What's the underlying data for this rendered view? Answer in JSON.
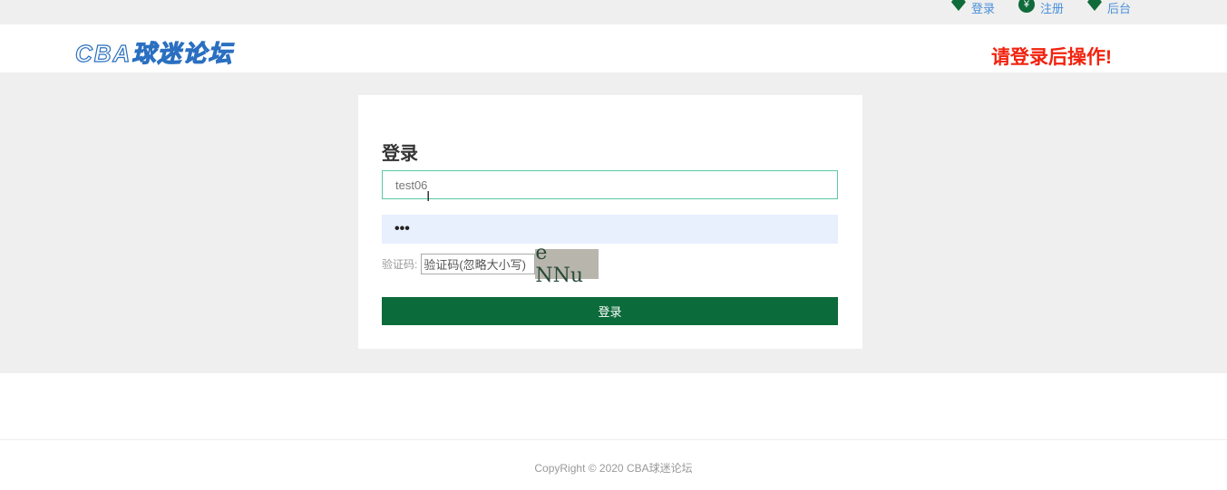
{
  "topbar": {
    "links": [
      {
        "label": "登录",
        "icon": "heart-icon"
      },
      {
        "label": "注册",
        "icon": "yen-icon"
      },
      {
        "label": "后台",
        "icon": "heart-icon"
      }
    ]
  },
  "header": {
    "logo": "CBA球迷论坛",
    "notice": "请登录后操作!"
  },
  "login": {
    "title": "登录",
    "username": "test06",
    "password": "•••",
    "captcha_label": "验证码:",
    "captcha_placeholder": "验证码(忽略大小写)",
    "captcha_image": "e NNu",
    "submit": "登录"
  },
  "footer": {
    "copyright": "CopyRight © 2020 CBA球迷论坛"
  }
}
